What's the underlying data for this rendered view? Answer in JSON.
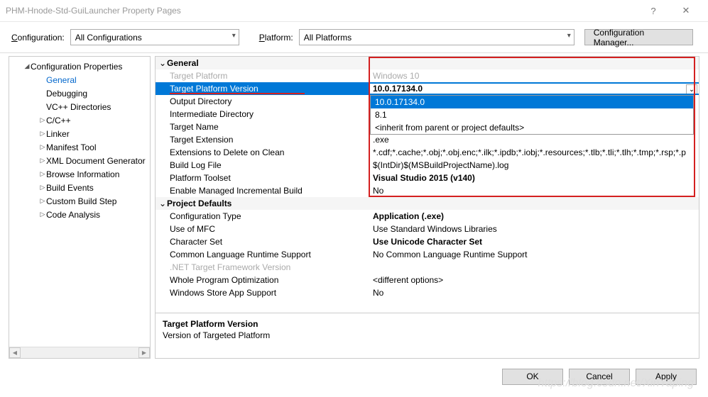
{
  "title": "PHM-Hnode-Std-GuiLauncher Property Pages",
  "config": {
    "label_html": "Configuration:",
    "value": "All Configurations",
    "platform_label": "Platform:",
    "platform_value": "All Platforms",
    "manager_btn": "Configuration Manager..."
  },
  "nav": {
    "root": "Configuration Properties",
    "items": [
      {
        "label": "General",
        "selected": true,
        "indent": 2
      },
      {
        "label": "Debugging",
        "indent": 2
      },
      {
        "label": "VC++ Directories",
        "indent": 2
      },
      {
        "label": "C/C++",
        "indent": 2,
        "expando": true
      },
      {
        "label": "Linker",
        "indent": 2,
        "expando": true
      },
      {
        "label": "Manifest Tool",
        "indent": 2,
        "expando": true
      },
      {
        "label": "XML Document Generator",
        "indent": 2,
        "expando": true
      },
      {
        "label": "Browse Information",
        "indent": 2,
        "expando": true
      },
      {
        "label": "Build Events",
        "indent": 2,
        "expando": true
      },
      {
        "label": "Custom Build Step",
        "indent": 2,
        "expando": true
      },
      {
        "label": "Code Analysis",
        "indent": 2,
        "expando": true
      }
    ]
  },
  "groups": {
    "general": "General",
    "defaults": "Project Defaults"
  },
  "props": {
    "target_platform": {
      "n": "Target Platform",
      "v": "Windows 10",
      "gray": true
    },
    "target_platform_version": {
      "n": "Target Platform Version",
      "v": "10.0.17134.0",
      "bold": true,
      "selected": true
    },
    "output_dir": {
      "n": "Output Directory",
      "v": ""
    },
    "intermediate_dir": {
      "n": "Intermediate Directory",
      "v": ""
    },
    "target_name": {
      "n": "Target Name",
      "v": ""
    },
    "target_ext": {
      "n": "Target Extension",
      "v": ".exe"
    },
    "ext_delete": {
      "n": "Extensions to Delete on Clean",
      "v": "*.cdf;*.cache;*.obj;*.obj.enc;*.ilk;*.ipdb;*.iobj;*.resources;*.tlb;*.tli;*.tlh;*.tmp;*.rsp;*.p"
    },
    "build_log": {
      "n": "Build Log File",
      "v": "$(IntDir)$(MSBuildProjectName).log"
    },
    "toolset": {
      "n": "Platform Toolset",
      "v": "Visual Studio 2015 (v140)",
      "bold": true
    },
    "incremental": {
      "n": "Enable Managed Incremental Build",
      "v": "No"
    },
    "cfg_type": {
      "n": "Configuration Type",
      "v": "Application (.exe)",
      "bold": true
    },
    "mfc": {
      "n": "Use of MFC",
      "v": "Use Standard Windows Libraries"
    },
    "charset": {
      "n": "Character Set",
      "v": "Use Unicode Character Set",
      "bold": true
    },
    "clr": {
      "n": "Common Language Runtime Support",
      "v": "No Common Language Runtime Support"
    },
    "netfx": {
      "n": ".NET Target Framework Version",
      "v": "",
      "gray": true
    },
    "wpo": {
      "n": "Whole Program Optimization",
      "v": "<different options>"
    },
    "store": {
      "n": "Windows Store App Support",
      "v": "No"
    }
  },
  "dropdown": {
    "options": [
      "10.0.17134.0",
      "8.1",
      "<inherit from parent or project defaults>"
    ],
    "selected": 0
  },
  "desc": {
    "title": "Target Platform Version",
    "body": "Version of Targeted Platform"
  },
  "footer": {
    "ok": "OK",
    "cancel": "Cancel",
    "apply": "Apply"
  },
  "watermark": "https://blog.csdn.net/XinYaping"
}
